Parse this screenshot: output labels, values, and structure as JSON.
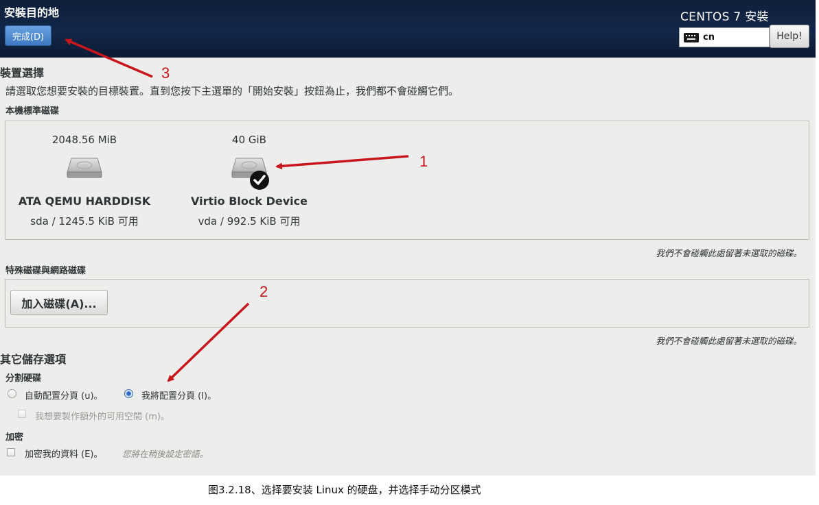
{
  "header": {
    "title": "安裝目的地",
    "done_label": "完成(D)",
    "product": "CENTOS 7 安裝",
    "keyboard_layout": "cn",
    "help_label": "Help!"
  },
  "device_selection": {
    "heading": "裝置選擇",
    "intro": "請選取您想要安裝的目標裝置。直到您按下主選單的「開始安裝」按鈕為止，我們都不會碰觸它們。",
    "local_label": "本機標準磁碟",
    "disks": [
      {
        "size": "2048.56 MiB",
        "name": "ATA QEMU HARDDISK",
        "info": "sda  /  1245.5 KiB 可用",
        "selected": false
      },
      {
        "size": "40 GiB",
        "name": "Virtio Block Device",
        "info": "vda  /  992.5 KiB 可用",
        "selected": true
      }
    ],
    "local_note": "我們不會碰觸此處留著未選取的磁碟。",
    "special_label": "特殊磁碟與網路磁碟",
    "add_disk_label": "加入磁碟(A)...",
    "special_note": "我們不會碰觸此處留著未選取的磁碟。"
  },
  "other_storage": {
    "heading": "其它儲存選項",
    "partitioning_label": "分割硬碟",
    "auto_option": "自動配置分頁 (u)。",
    "manual_option": "我將配置分頁 (I)。",
    "extra_space_option": "我想要製作額外的可用空間 (m)。",
    "encryption_label": "加密",
    "encrypt_option": "加密我的資料 (E)。",
    "passphrase_hint": "您將在稍後設定密語。"
  },
  "annotations": {
    "marker_1": "1",
    "marker_2": "2",
    "marker_3": "3",
    "arrow_color": "#c8161d"
  },
  "caption": "图3.2.18、选择要安装 Linux 的硬盘，并选择手动分区模式"
}
